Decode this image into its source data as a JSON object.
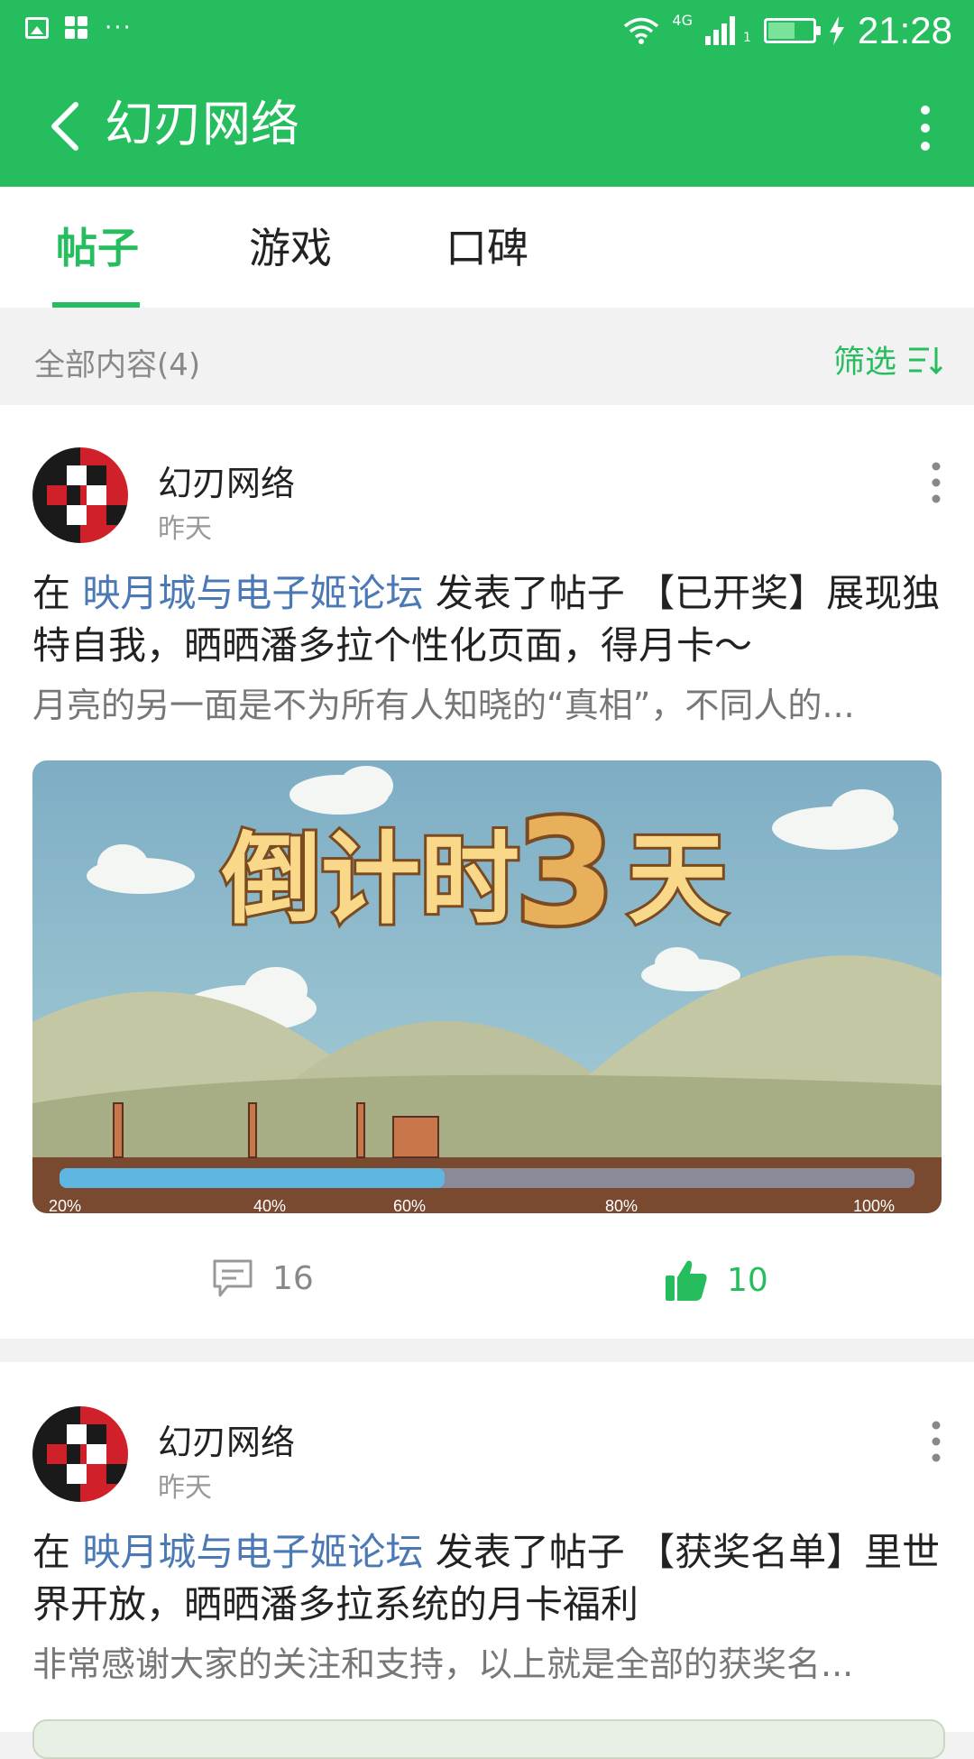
{
  "status_bar": {
    "network": "4G",
    "signal_sub": "1",
    "time": "21:28",
    "dots": "···",
    "battery_level": 0.6
  },
  "app_bar": {
    "title": "幻刃网络"
  },
  "tabs": [
    {
      "label": "帖子",
      "active": true
    },
    {
      "label": "游戏",
      "active": false
    },
    {
      "label": "口碑",
      "active": false
    }
  ],
  "filter_bar": {
    "count_label": "全部内容(4)",
    "filter_label": "筛选"
  },
  "posts": [
    {
      "author": "幻刃网络",
      "date": "昨天",
      "prefix": "在",
      "forum": "映月城与电子姬论坛",
      "action": "发表了帖子",
      "title_rest": "【已开奖】展现独特自我，晒晒潘多拉个性化页面，得月卡～",
      "excerpt": "月亮的另一面是不为所有人知晓的“真相”，不同人的...",
      "image": {
        "banner_text_1": "倒计时",
        "banner_text_2": "3",
        "banner_text_3": "天",
        "progress_labels": [
          "20%",
          "40%",
          "60%",
          "80%",
          "100%"
        ],
        "progress": 0.45
      },
      "comments": "16",
      "likes": "10"
    },
    {
      "author": "幻刃网络",
      "date": "昨天",
      "prefix": "在",
      "forum": "映月城与电子姬论坛",
      "action": "发表了帖子",
      "title_rest": "【获奖名单】里世界开放，晒晒潘多拉系统的月卡福利",
      "excerpt": "非常感谢大家的关注和支持，以上就是全部的获奖名..."
    }
  ],
  "colors": {
    "brand_green": "#26bd5f",
    "forum_link": "#4a79b5"
  }
}
